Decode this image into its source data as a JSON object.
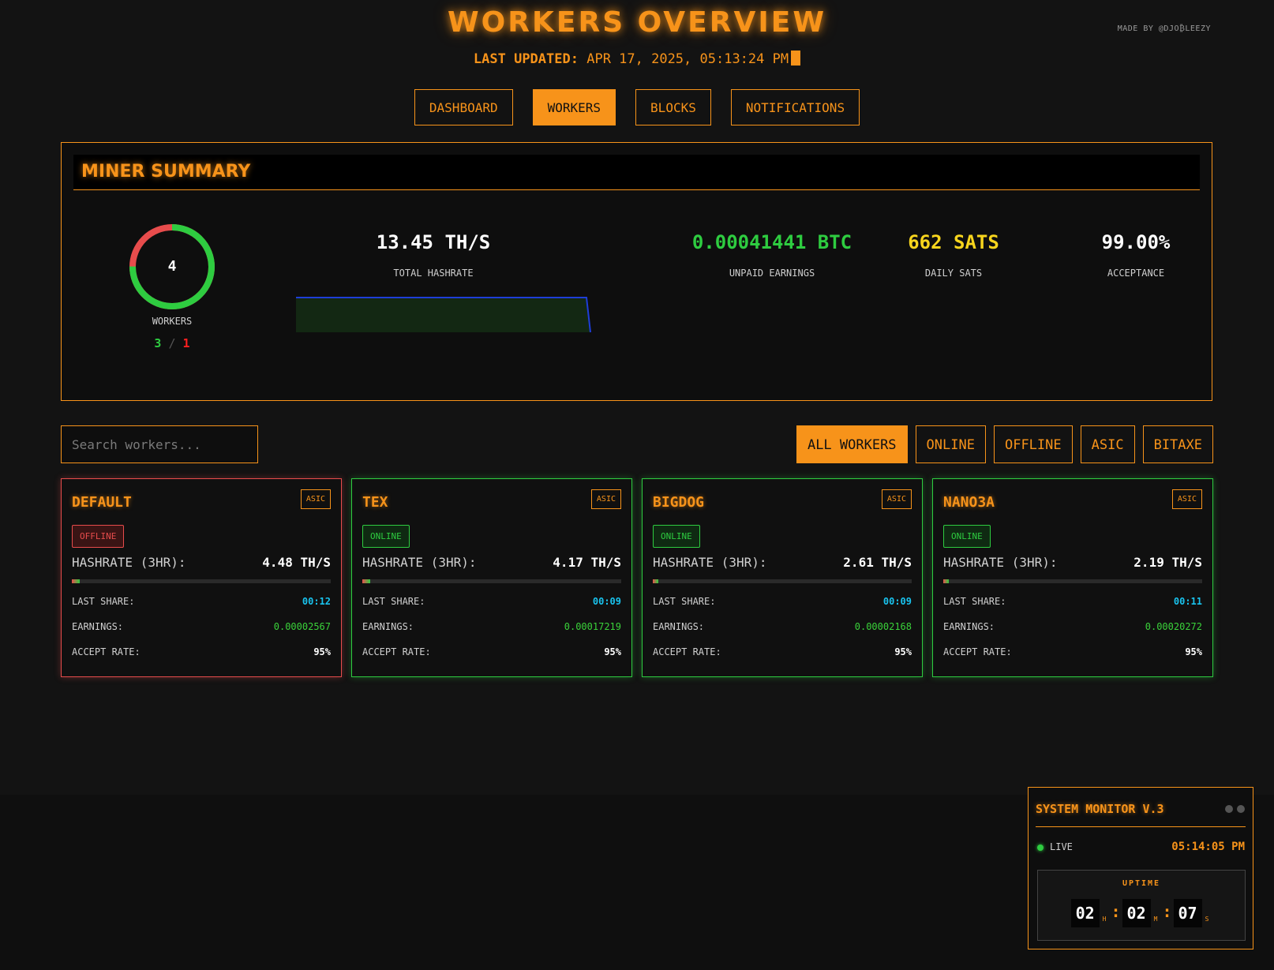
{
  "header": {
    "title": "WORKERS OVERVIEW",
    "made_by": "MADE BY @DJO₿LEEZY",
    "last_updated_label": "LAST UPDATED:",
    "last_updated_value": "APR 17, 2025, 05:13:24 PM"
  },
  "nav": {
    "dashboard": "DASHBOARD",
    "workers": "WORKERS",
    "blocks": "BLOCKS",
    "notifications": "NOTIFICATIONS",
    "active": "WORKERS"
  },
  "summary": {
    "title": "MINER SUMMARY",
    "workers_total": "4",
    "workers_label": "WORKERS",
    "workers_online": "3",
    "workers_sep": "/",
    "workers_offline": "1",
    "hashrate_value": "13.45 TH/S",
    "hashrate_label": "TOTAL HASHRATE",
    "unpaid_value": "0.00041441 BTC",
    "unpaid_label": "UNPAID EARNINGS",
    "daily_value": "662 SATS",
    "daily_label": "DAILY SATS",
    "acceptance_value": "99.00%",
    "acceptance_label": "ACCEPTANCE"
  },
  "search": {
    "placeholder": "Search workers..."
  },
  "filters": {
    "all": "ALL WORKERS",
    "online": "ONLINE",
    "offline": "OFFLINE",
    "asic": "ASIC",
    "bitaxe": "BITAXE",
    "active": "ALL WORKERS"
  },
  "labels": {
    "hashrate": "HASHRATE (3HR):",
    "last_share": "LAST SHARE:",
    "earnings": "EARNINGS:",
    "accept_rate": "ACCEPT RATE:"
  },
  "workers": [
    {
      "name": "DEFAULT",
      "type": "ASIC",
      "status": "OFFLINE",
      "hashrate": "4.48 TH/S",
      "hashrate_fraction": 0.03,
      "last_share": "00:12",
      "earnings": "0.00002567",
      "accept_rate": "95%"
    },
    {
      "name": "TEX",
      "type": "ASIC",
      "status": "ONLINE",
      "hashrate": "4.17 TH/S",
      "hashrate_fraction": 0.03,
      "last_share": "00:09",
      "earnings": "0.00017219",
      "accept_rate": "95%"
    },
    {
      "name": "BIGDOG",
      "type": "ASIC",
      "status": "ONLINE",
      "hashrate": "2.61 TH/S",
      "hashrate_fraction": 0.02,
      "last_share": "00:09",
      "earnings": "0.00002168",
      "accept_rate": "95%"
    },
    {
      "name": "NANO3A",
      "type": "ASIC",
      "status": "ONLINE",
      "hashrate": "2.19 TH/S",
      "hashrate_fraction": 0.02,
      "last_share": "00:11",
      "earnings": "0.00020272",
      "accept_rate": "95%"
    }
  ],
  "monitor": {
    "title": "SYSTEM MONITOR V.3",
    "live": "LIVE",
    "time": "05:14:05 PM",
    "uptime_label": "UPTIME",
    "hours": "02",
    "hours_unit": "H",
    "minutes": "02",
    "minutes_unit": "M",
    "seconds": "07",
    "seconds_unit": "S",
    "sep": ":"
  },
  "colors": {
    "accent": "#f7931a",
    "online": "#2ecc40",
    "offline": "#e74c4c",
    "cyan": "#19c3ee",
    "sats": "#f7d51d"
  },
  "icons": [
    "window-dots-icon",
    "live-dot-icon"
  ]
}
